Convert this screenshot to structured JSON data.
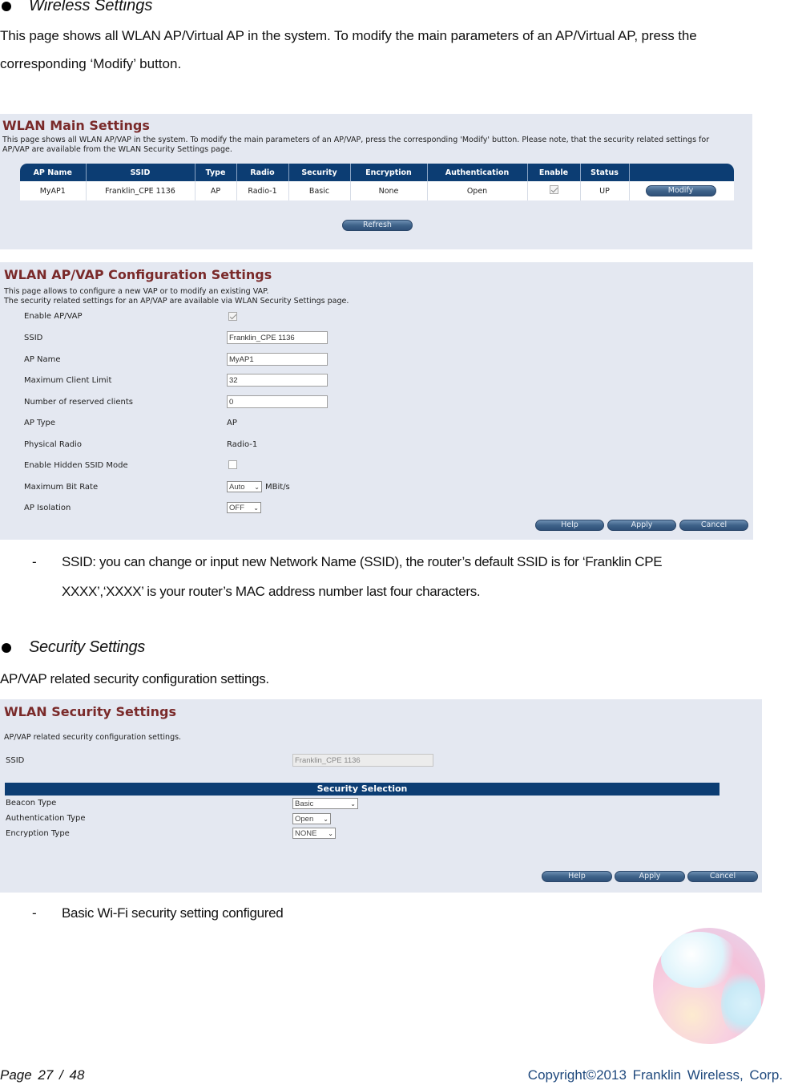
{
  "doc": {
    "section1": {
      "heading": "Wireless Settings",
      "paragraph_line1": "This page shows all WLAN AP/Virtual AP in the system. To modify the main parameters of an AP/Virtual AP, press the",
      "paragraph_line2": "corresponding ‘Modify’ button."
    },
    "ssid_note": {
      "dash": "-",
      "line1": "SSID:  you  can  change  or  input  new  Network  Name  (SSID),  the  router’s  default  SSID  is  for  ‘Franklin  CPE",
      "line2": "XXXX’,‘XXXX’ is your router’s MAC address number last four characters."
    },
    "section2": {
      "heading": "Security Settings",
      "paragraph": "AP/VAP related security configuration settings."
    },
    "security_note": {
      "dash": "-",
      "text": "Basic Wi-Fi security setting configured"
    },
    "footer": {
      "page_label": "Page  27  /  48",
      "copyright": "Copyright©2013  Franklin  Wireless, Corp."
    },
    "logo_icon": "franklin-sphere-logo"
  },
  "wlan_main": {
    "title": "WLAN Main Settings",
    "desc_line1": "This page shows all WLAN AP/VAP in the system. To modify the main parameters of an AP/VAP, press the corresponding 'Modify' button. Please note, that the security related settings for",
    "desc_line2": "AP/VAP are available from the WLAN Security Settings page.",
    "columns": [
      "AP Name",
      "SSID",
      "Type",
      "Radio",
      "Security",
      "Encryption",
      "Authentication",
      "Enable",
      "Status",
      ""
    ],
    "rows": [
      {
        "ap_name": "MyAP1",
        "ssid": "Franklin_CPE 1136",
        "type": "AP",
        "radio": "Radio-1",
        "security": "Basic",
        "encryption": "None",
        "authentication": "Open",
        "enabled": true,
        "status": "UP",
        "action_label": "Modify"
      }
    ],
    "refresh_label": "Refresh"
  },
  "wlan_config": {
    "title": "WLAN AP/VAP Configuration Settings",
    "desc_line1": "This page allows to configure a new VAP or to modify an existing VAP.",
    "desc_line2": "The security related settings for an AP/VAP are available via WLAN Security Settings page.",
    "fields": {
      "enable_ap_label": "Enable AP/VAP",
      "enable_ap_checked": true,
      "ssid_label": "SSID",
      "ssid_value": "Franklin_CPE 1136",
      "ap_name_label": "AP Name",
      "ap_name_value": "MyAP1",
      "max_client_label": "Maximum Client Limit",
      "max_client_value": "32",
      "reserved_label": "Number of reserved clients",
      "reserved_value": "0",
      "ap_type_label": "AP Type",
      "ap_type_value": "AP",
      "radio_label": "Physical Radio",
      "radio_value": "Radio-1",
      "hidden_ssid_label": "Enable Hidden SSID Mode",
      "hidden_ssid_checked": false,
      "bitrate_label": "Maximum Bit Rate",
      "bitrate_value": "Auto",
      "bitrate_unit": "MBit/s",
      "isolation_label": "AP Isolation",
      "isolation_value": "OFF"
    },
    "buttons": {
      "help": "Help",
      "apply": "Apply",
      "cancel": "Cancel"
    }
  },
  "wlan_security": {
    "title": "WLAN Security Settings",
    "desc": "AP/VAP related security configuration settings.",
    "ssid_label": "SSID",
    "ssid_value": "Franklin_CPE 1136",
    "section_header": "Security Selection",
    "beacon_label": "Beacon Type",
    "beacon_value": "Basic",
    "auth_label": "Authentication Type",
    "auth_value": "Open",
    "enc_label": "Encryption Type",
    "enc_value": "NONE",
    "buttons": {
      "help": "Help",
      "apply": "Apply",
      "cancel": "Cancel"
    }
  },
  "colors": {
    "panel_bg": "#e4e8f1",
    "table_header": "#0c3d73",
    "title_red": "#7a2a2a",
    "footer_blue": "#1f497d"
  }
}
